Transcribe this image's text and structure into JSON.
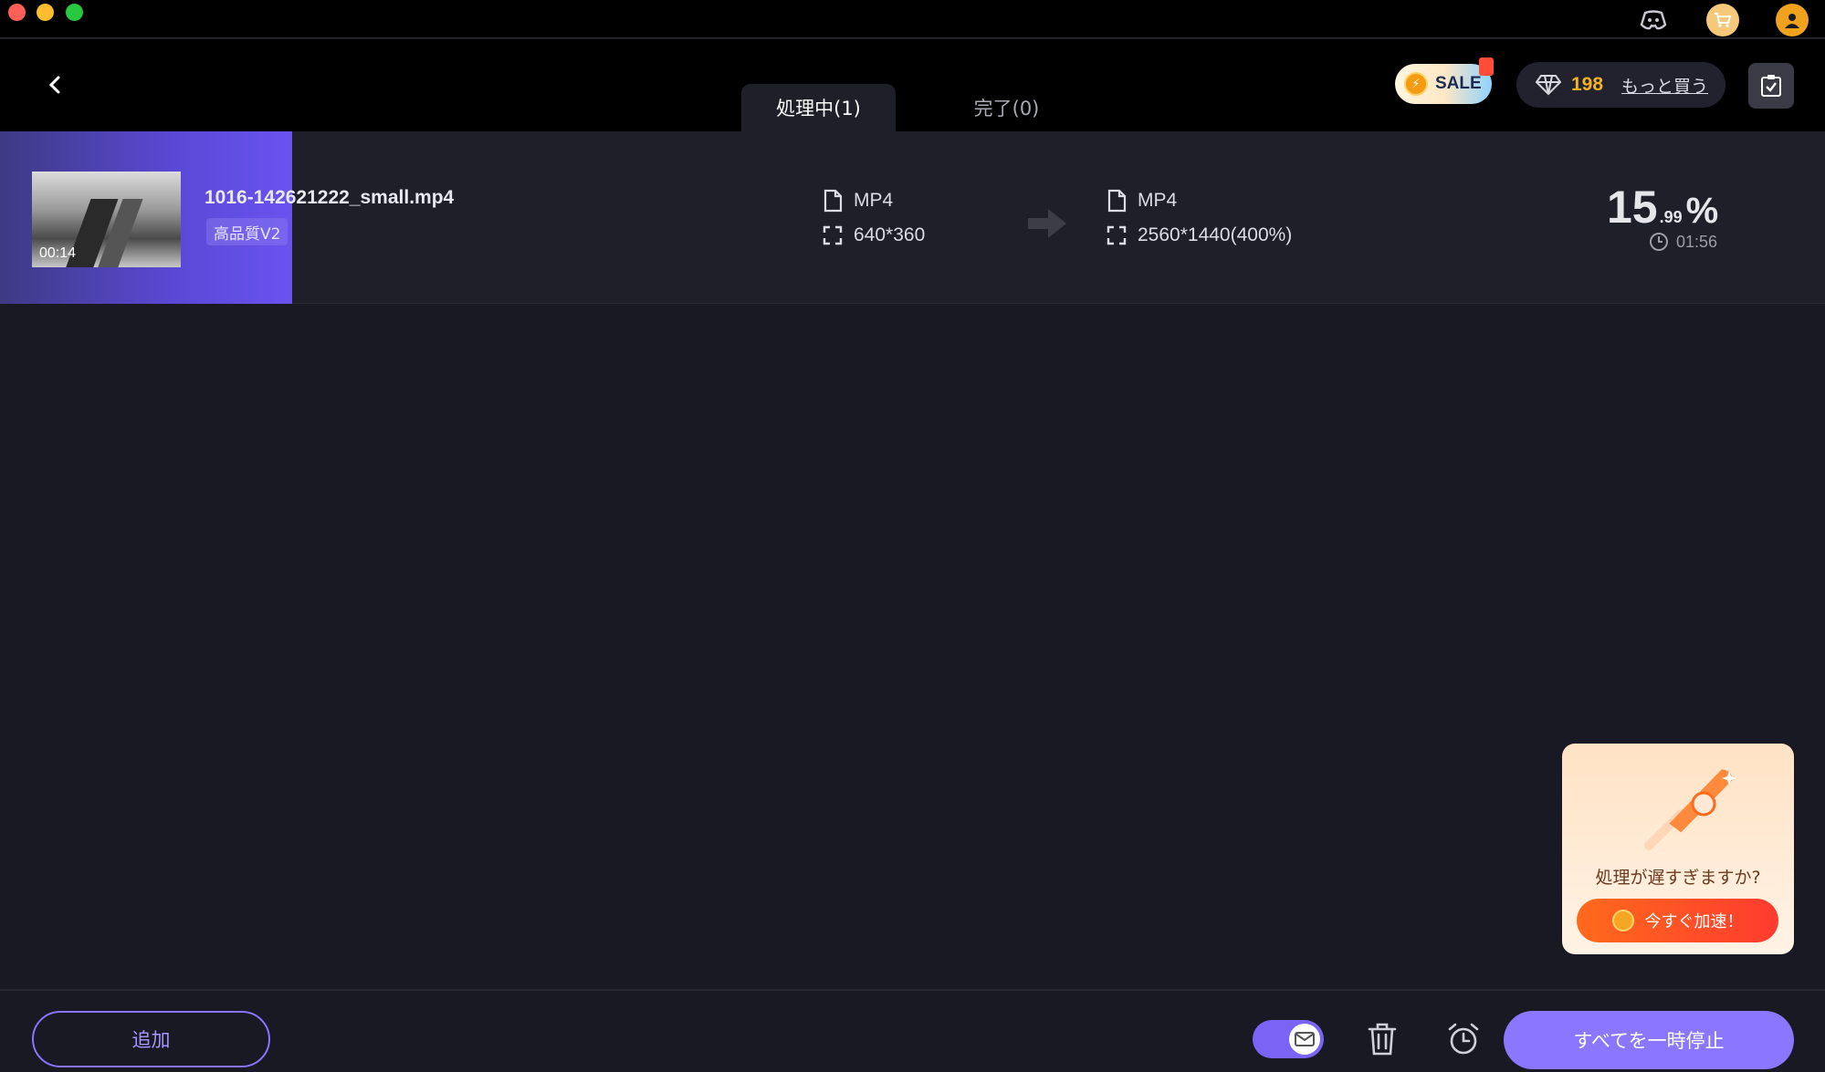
{
  "header": {
    "tabs": [
      {
        "label": "処理中(1)",
        "active": true
      },
      {
        "label": "完了(0)",
        "active": false
      }
    ],
    "sale_label": "SALE",
    "credits": {
      "count": "198",
      "buy_more": "もっと買う"
    }
  },
  "task": {
    "filename": "1016-142621222_small.mp4",
    "thumb_duration": "00:14",
    "quality_tag": "高品質V2",
    "source": {
      "format": "MP4",
      "resolution": "640*360"
    },
    "target": {
      "format": "MP4",
      "resolution": "2560*1440(400%)"
    },
    "progress": {
      "int": "15",
      "dec": ".99",
      "sign": "%",
      "fraction": 0.1599
    },
    "eta": "01:56"
  },
  "promo": {
    "title": "処理が遅すぎますか?",
    "button": "今すぐ加速！"
  },
  "footer": {
    "add_label": "追加",
    "pause_all_label": "すべてを一時停止"
  },
  "colors": {
    "accent": "#8a76ff",
    "progress": "#5a49d6",
    "credits": "#f5b324",
    "boost": "#ff4d2a"
  },
  "icons": [
    "discord-icon",
    "cart-icon",
    "user-icon",
    "back-icon",
    "gem-icon",
    "clipboard-icon",
    "file-icon",
    "resolution-icon",
    "arrow-right-icon",
    "clock-icon",
    "rocket-icon",
    "mail-icon",
    "trash-icon",
    "alarm-icon"
  ]
}
